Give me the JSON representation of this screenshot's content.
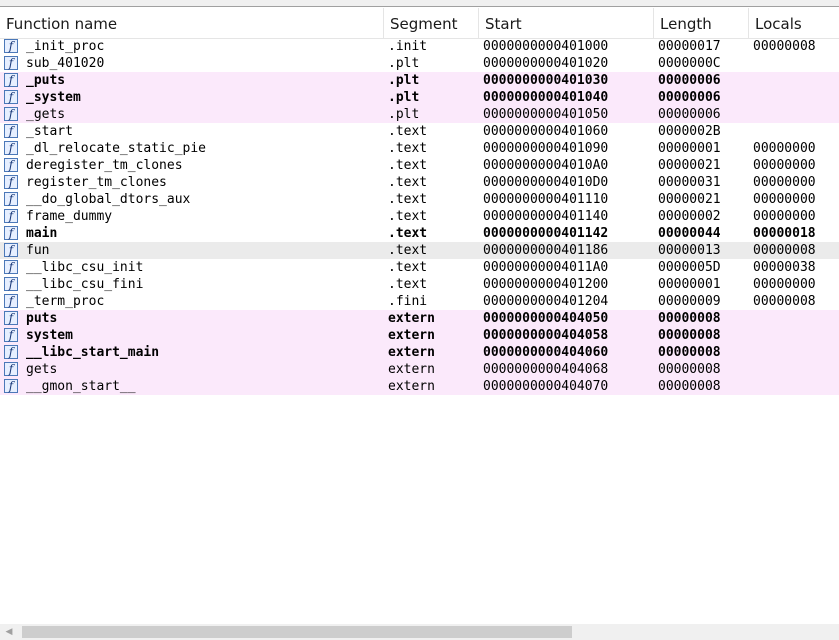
{
  "columns": {
    "function_name": "Function name",
    "segment": "Segment",
    "start": "Start",
    "length": "Length",
    "locals": "Locals"
  },
  "icons": {
    "function": "function-icon",
    "scroll_left": "scroll-left-arrow-icon"
  },
  "rows": [
    {
      "name": "_init_proc",
      "segment": ".init",
      "start": "0000000000401000",
      "length": "00000017",
      "locals": "00000008",
      "style": "normal"
    },
    {
      "name": "sub_401020",
      "segment": ".plt",
      "start": "0000000000401020",
      "length": "0000000C",
      "locals": "",
      "style": "normal"
    },
    {
      "name": "_puts",
      "segment": ".plt",
      "start": "0000000000401030",
      "length": "00000006",
      "locals": "",
      "style": "pink-bold"
    },
    {
      "name": "_system",
      "segment": ".plt",
      "start": "0000000000401040",
      "length": "00000006",
      "locals": "",
      "style": "pink-bold"
    },
    {
      "name": "_gets",
      "segment": ".plt",
      "start": "0000000000401050",
      "length": "00000006",
      "locals": "",
      "style": "pink"
    },
    {
      "name": "_start",
      "segment": ".text",
      "start": "0000000000401060",
      "length": "0000002B",
      "locals": "",
      "style": "normal"
    },
    {
      "name": "_dl_relocate_static_pie",
      "segment": ".text",
      "start": "0000000000401090",
      "length": "00000001",
      "locals": "00000000",
      "style": "normal"
    },
    {
      "name": "deregister_tm_clones",
      "segment": ".text",
      "start": "00000000004010A0",
      "length": "00000021",
      "locals": "00000000",
      "style": "normal"
    },
    {
      "name": "register_tm_clones",
      "segment": ".text",
      "start": "00000000004010D0",
      "length": "00000031",
      "locals": "00000000",
      "style": "normal"
    },
    {
      "name": "__do_global_dtors_aux",
      "segment": ".text",
      "start": "0000000000401110",
      "length": "00000021",
      "locals": "00000000",
      "style": "normal"
    },
    {
      "name": "frame_dummy",
      "segment": ".text",
      "start": "0000000000401140",
      "length": "00000002",
      "locals": "00000000",
      "style": "normal"
    },
    {
      "name": "main",
      "segment": ".text",
      "start": "0000000000401142",
      "length": "00000044",
      "locals": "00000018",
      "style": "bold"
    },
    {
      "name": "fun",
      "segment": ".text",
      "start": "0000000000401186",
      "length": "00000013",
      "locals": "00000008",
      "style": "selected"
    },
    {
      "name": "__libc_csu_init",
      "segment": ".text",
      "start": "00000000004011A0",
      "length": "0000005D",
      "locals": "00000038",
      "style": "normal"
    },
    {
      "name": "__libc_csu_fini",
      "segment": ".text",
      "start": "0000000000401200",
      "length": "00000001",
      "locals": "00000000",
      "style": "normal"
    },
    {
      "name": "_term_proc",
      "segment": ".fini",
      "start": "0000000000401204",
      "length": "00000009",
      "locals": "00000008",
      "style": "normal"
    },
    {
      "name": "puts",
      "segment": "extern",
      "start": "0000000000404050",
      "length": "00000008",
      "locals": "",
      "style": "pink-bold"
    },
    {
      "name": "system",
      "segment": "extern",
      "start": "0000000000404058",
      "length": "00000008",
      "locals": "",
      "style": "pink-bold"
    },
    {
      "name": "__libc_start_main",
      "segment": "extern",
      "start": "0000000000404060",
      "length": "00000008",
      "locals": "",
      "style": "pink-bold"
    },
    {
      "name": "gets",
      "segment": "extern",
      "start": "0000000000404068",
      "length": "00000008",
      "locals": "",
      "style": "pink"
    },
    {
      "name": "__gmon_start__",
      "segment": "extern",
      "start": "0000000000404070",
      "length": "00000008",
      "locals": "",
      "style": "pink"
    }
  ]
}
